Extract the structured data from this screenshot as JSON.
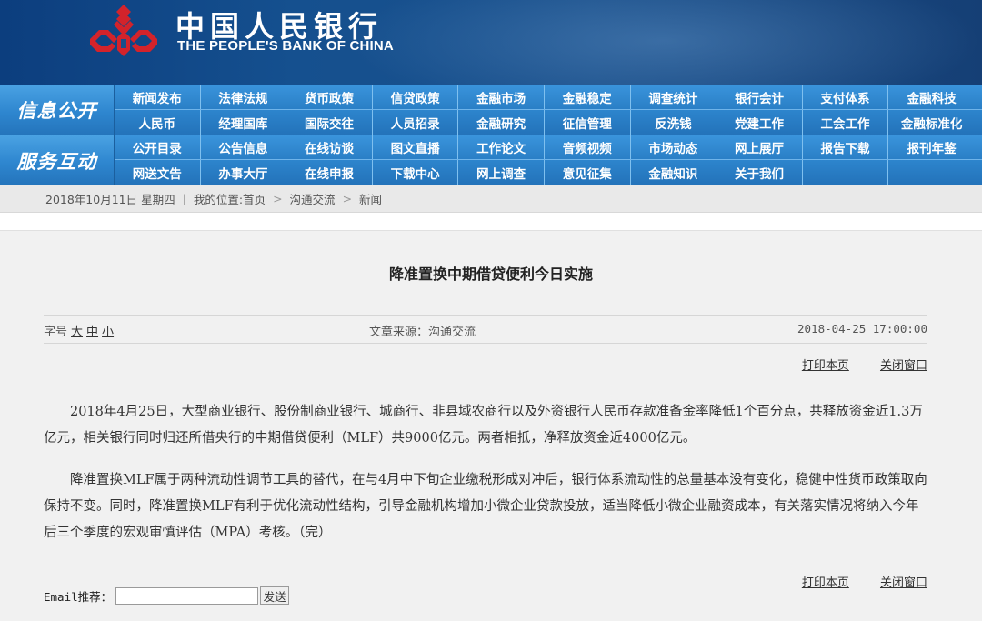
{
  "header": {
    "bank_name_cn": "中国人民银行",
    "bank_name_en": "THE PEOPLE'S BANK OF CHINA",
    "logo_icon": "pboc-logo-icon",
    "logo_color": "#d3232b"
  },
  "nav": {
    "groups": [
      {
        "label": "信息公开",
        "rows": [
          [
            "新闻发布",
            "法律法规",
            "货币政策",
            "信贷政策",
            "金融市场",
            "金融稳定",
            "调查统计",
            "银行会计",
            "支付体系",
            "金融科技"
          ],
          [
            "人民币",
            "经理国库",
            "国际交往",
            "人员招录",
            "金融研究",
            "征信管理",
            "反洗钱",
            "党建工作",
            "工会工作",
            "金融标准化"
          ]
        ]
      },
      {
        "label": "服务互动",
        "rows": [
          [
            "公开目录",
            "公告信息",
            "在线访谈",
            "图文直播",
            "工作论文",
            "音频视频",
            "市场动态",
            "网上展厅",
            "报告下载",
            "报刊年鉴"
          ],
          [
            "网送文告",
            "办事大厅",
            "在线申报",
            "下载中心",
            "网上调查",
            "意见征集",
            "金融知识",
            "关于我们",
            "",
            ""
          ]
        ]
      }
    ]
  },
  "breadcrumb": {
    "date": "2018年10月11日 星期四",
    "divider": "|",
    "location_prefix": "我的位置:",
    "home": "首页",
    "sep": ">",
    "level1": "沟通交流",
    "level2": "新闻"
  },
  "article": {
    "title": "降准置换中期借贷便利今日实施",
    "font_size_label": "字号",
    "font_sizes": [
      "大",
      "中",
      "小"
    ],
    "source": "文章来源：沟通交流",
    "datetime": "2018-04-25 17:00:00",
    "print_label": "打印本页",
    "close_label": "关闭窗口",
    "paragraphs": [
      "2018年4月25日，大型商业银行、股份制商业银行、城商行、非县域农商行以及外资银行人民币存款准备金率降低1个百分点，共释放资金近1.3万亿元，相关银行同时归还所借央行的中期借贷便利（MLF）共9000亿元。两者相抵，净释放资金近4000亿元。",
      "降准置换MLF属于两种流动性调节工具的替代，在与4月中下旬企业缴税形成对冲后，银行体系流动性的总量基本没有变化，稳健中性货币政策取向保持不变。同时，降准置换MLF有利于优化流动性结构，引导金融机构增加小微企业贷款投放，适当降低小微企业融资成本，有关落实情况将纳入今年后三个季度的宏观审慎评估（MPA）考核。（完）"
    ],
    "email_label": "Email推荐：",
    "email_value": "",
    "send_label": "发送"
  }
}
